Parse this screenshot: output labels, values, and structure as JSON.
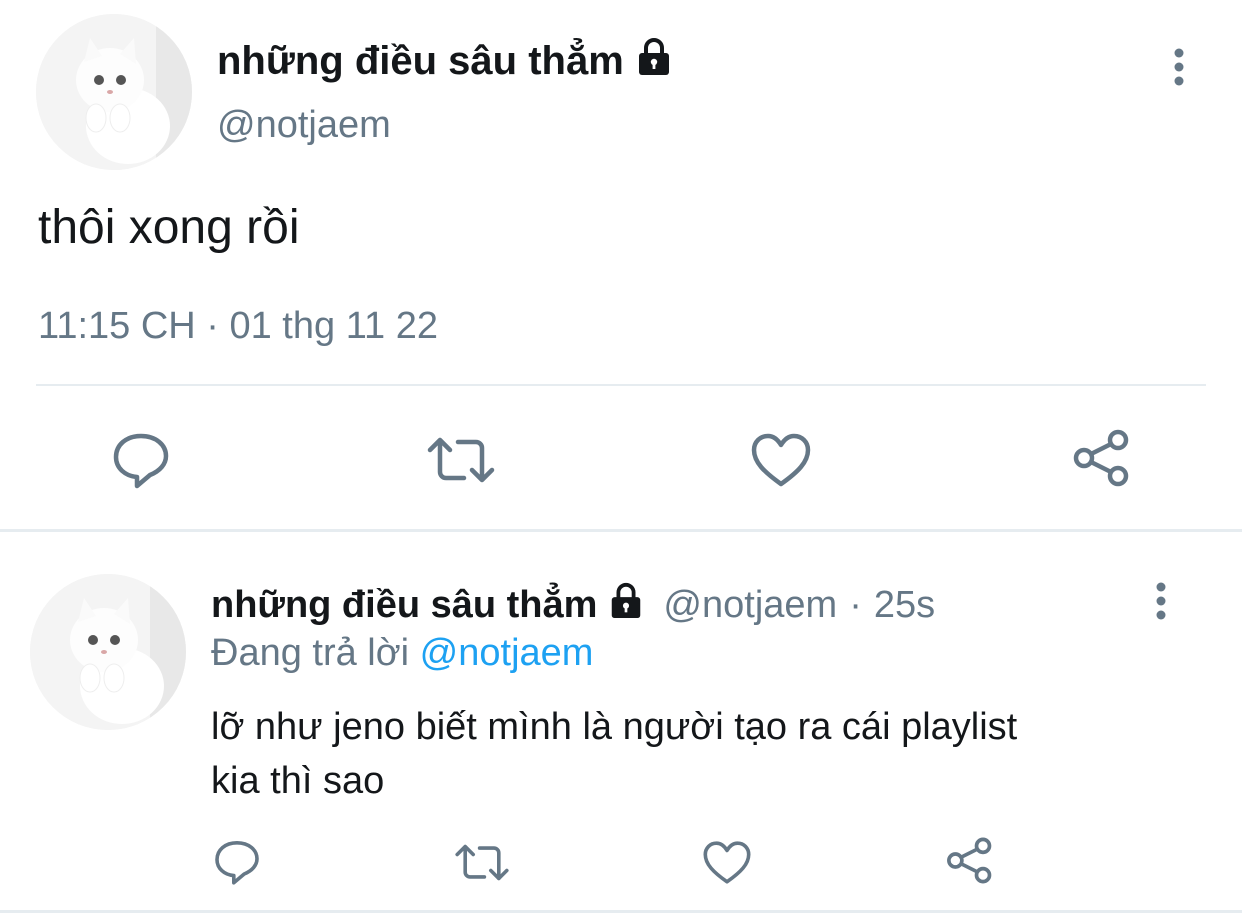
{
  "main_tweet": {
    "display_name": "những điều sâu thẳm",
    "handle": "@notjaem",
    "text": "thôi xong rồi",
    "timestamp": "11:15 CH · 01 thg 11 22",
    "protected_icon": "lock-icon",
    "menu_icon": "more-vertical-icon",
    "actions": [
      "reply-icon",
      "retweet-icon",
      "like-icon",
      "share-icon"
    ]
  },
  "reply_tweet": {
    "display_name": "những điều sâu thẳm",
    "handle": "@notjaem",
    "separator": "·",
    "time_ago": "25s",
    "replying_prefix": "Đang trả lời",
    "replying_to": "@notjaem",
    "text_line1": "lỡ như jeno biết mình là người tạo ra cái playlist",
    "text_line2": "kia thì sao",
    "protected_icon": "lock-icon",
    "menu_icon": "more-vertical-icon",
    "actions": [
      "reply-icon",
      "retweet-icon",
      "like-icon",
      "share-icon"
    ]
  },
  "colors": {
    "text_primary": "#14171a",
    "text_secondary": "#657786",
    "link": "#1da1f2",
    "divider": "#e6ecf0",
    "icon": "#657786"
  }
}
